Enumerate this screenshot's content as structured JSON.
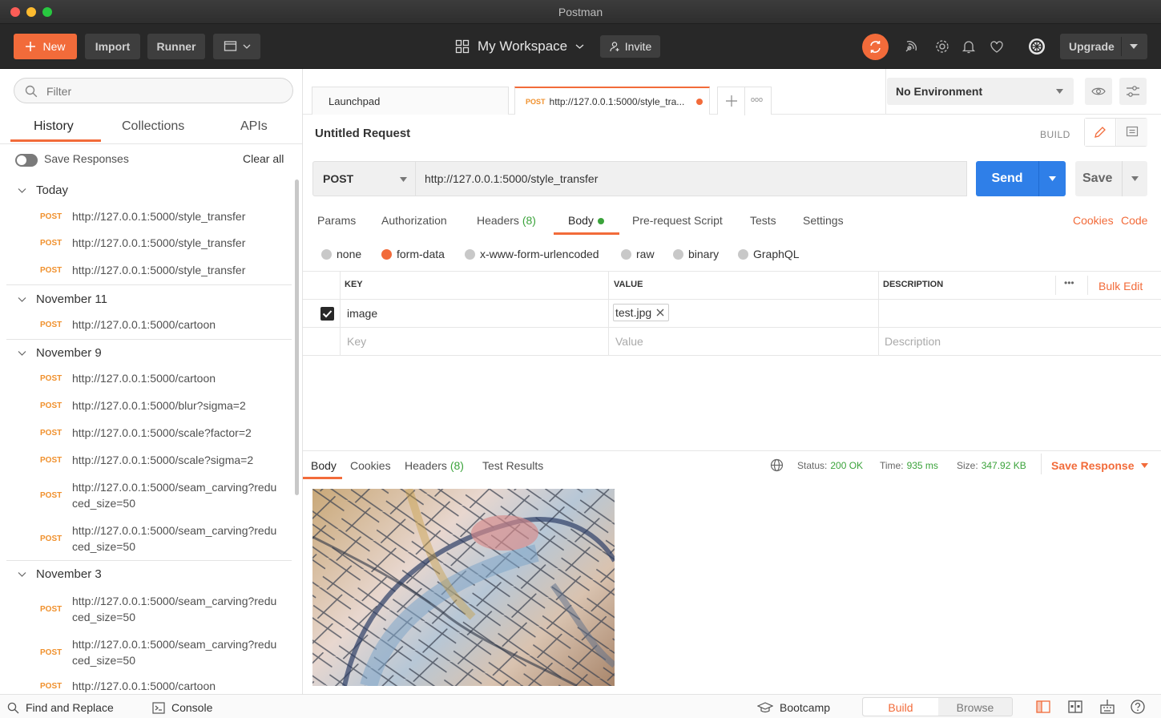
{
  "window": {
    "title": "Postman"
  },
  "header": {
    "new_label": "New",
    "import_label": "Import",
    "runner_label": "Runner",
    "workspace_label": "My Workspace",
    "invite_label": "Invite",
    "upgrade_label": "Upgrade"
  },
  "sidebar": {
    "filter_placeholder": "Filter",
    "tabs": [
      "History",
      "Collections",
      "APIs"
    ],
    "save_responses_label": "Save Responses",
    "clear_all_label": "Clear all",
    "groups": [
      {
        "label": "Today",
        "items": [
          {
            "method": "POST",
            "url": "http://127.0.0.1:5000/style_transfer"
          },
          {
            "method": "POST",
            "url": "http://127.0.0.1:5000/style_transfer"
          },
          {
            "method": "POST",
            "url": "http://127.0.0.1:5000/style_transfer"
          }
        ]
      },
      {
        "label": "November 11",
        "items": [
          {
            "method": "POST",
            "url": "http://127.0.0.1:5000/cartoon"
          }
        ]
      },
      {
        "label": "November 9",
        "items": [
          {
            "method": "POST",
            "url": "http://127.0.0.1:5000/cartoon"
          },
          {
            "method": "POST",
            "url": "http://127.0.0.1:5000/blur?sigma=2"
          },
          {
            "method": "POST",
            "url": "http://127.0.0.1:5000/scale?factor=2"
          },
          {
            "method": "POST",
            "url": "http://127.0.0.1:5000/scale?sigma=2"
          },
          {
            "method": "POST",
            "url1": "http://127.0.0.1:5000/seam_carving?redu",
            "url2": "ced_size=50"
          },
          {
            "method": "POST",
            "url1": "http://127.0.0.1:5000/seam_carving?redu",
            "url2": "ced_size=50"
          }
        ]
      },
      {
        "label": "November 3",
        "items": [
          {
            "method": "POST",
            "url1": "http://127.0.0.1:5000/seam_carving?redu",
            "url2": "ced_size=50"
          },
          {
            "method": "POST",
            "url1": "http://127.0.0.1:5000/seam_carving?redu",
            "url2": "ced_size=50"
          },
          {
            "method": "POST",
            "url": "http://127.0.0.1:5000/cartoon"
          }
        ]
      }
    ]
  },
  "tabs": {
    "launchpad_label": "Launchpad",
    "active_method": "POST",
    "active_label": "http://127.0.0.1:5000/style_tra...",
    "more_label": "ooo"
  },
  "environment": {
    "selected": "No Environment"
  },
  "request": {
    "title": "Untitled Request",
    "build_label": "BUILD",
    "method": "POST",
    "url": "http://127.0.0.1:5000/style_transfer",
    "send_label": "Send",
    "save_label": "Save",
    "subtabs": {
      "params": "Params",
      "authorization": "Authorization",
      "headers": "Headers",
      "headers_count": "(8)",
      "body": "Body",
      "prerequest": "Pre-request Script",
      "tests": "Tests",
      "settings": "Settings"
    },
    "cookies_label": "Cookies",
    "code_label": "Code",
    "body_types": [
      "none",
      "form-data",
      "x-www-form-urlencoded",
      "raw",
      "binary",
      "GraphQL"
    ],
    "body_type_selected": "form-data",
    "table": {
      "headers": {
        "key": "KEY",
        "value": "VALUE",
        "description": "DESCRIPTION"
      },
      "bulk_edit_label": "Bulk Edit",
      "more_label": "•••",
      "rows": [
        {
          "key": "image",
          "value": "test.jpg",
          "checked": true
        }
      ],
      "placeholders": {
        "key": "Key",
        "value": "Value",
        "description": "Description"
      }
    }
  },
  "response": {
    "tabs": {
      "body": "Body",
      "cookies": "Cookies",
      "headers": "Headers",
      "headers_count": "(8)",
      "tests": "Test Results"
    },
    "status_label": "Status:",
    "status_value": "200 OK",
    "time_label": "Time:",
    "time_value": "935 ms",
    "size_label": "Size:",
    "size_value": "347.92 KB",
    "save_response_label": "Save Response"
  },
  "footer": {
    "find_replace_label": "Find and Replace",
    "console_label": "Console",
    "bootcamp_label": "Bootcamp",
    "build_label": "Build",
    "browse_label": "Browse"
  },
  "colors": {
    "accent": "#f26b3a",
    "send": "#2f7fe8",
    "status_ok": "#3ba33b",
    "method_post": "#f0902c"
  }
}
